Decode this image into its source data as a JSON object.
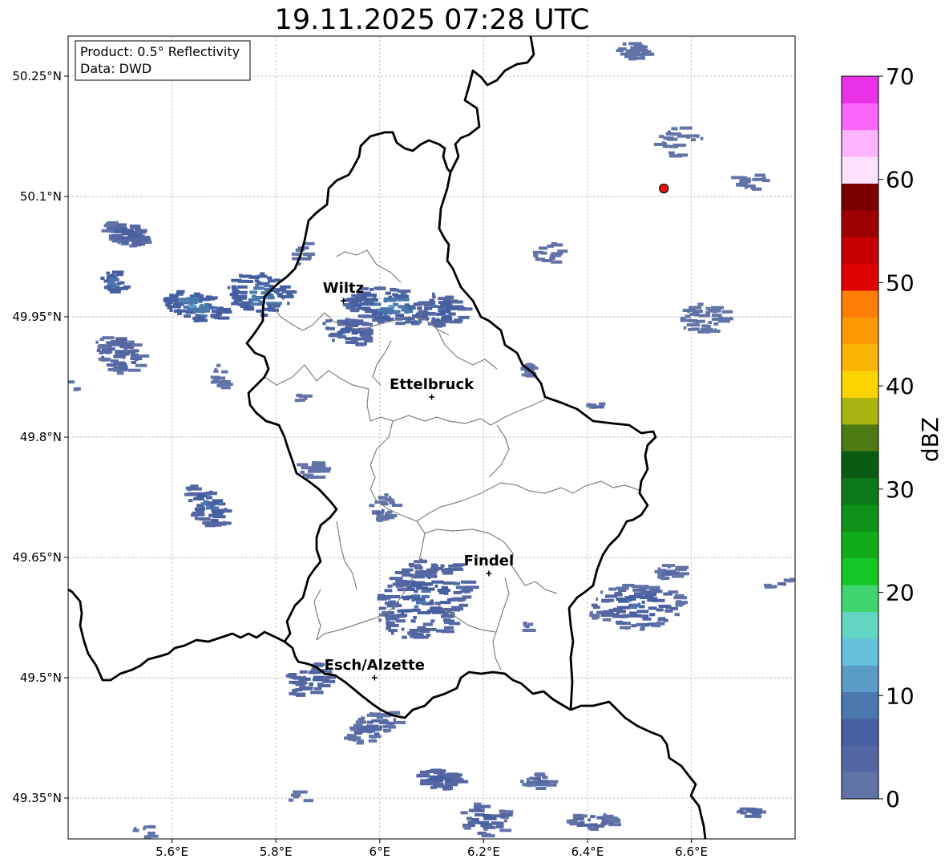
{
  "title": "19.11.2025 07:28 UTC",
  "info_box": {
    "product": "Product: 0.5° Reflectivity",
    "data": "Data: DWD"
  },
  "map": {
    "lon_range": [
      5.4,
      6.8
    ],
    "lat_range": [
      49.3,
      50.3
    ],
    "lon_ticks": [
      {
        "value": 5.6,
        "label": "5.6°E"
      },
      {
        "value": 5.8,
        "label": "5.8°E"
      },
      {
        "value": 6.0,
        "label": "6°E"
      },
      {
        "value": 6.2,
        "label": "6.2°E"
      },
      {
        "value": 6.4,
        "label": "6.4°E"
      },
      {
        "value": 6.6,
        "label": "6.6°E"
      }
    ],
    "lat_ticks": [
      {
        "value": 50.25,
        "label": "50.25°N"
      },
      {
        "value": 50.1,
        "label": "50.1°N"
      },
      {
        "value": 49.95,
        "label": "49.95°N"
      },
      {
        "value": 49.8,
        "label": "49.8°N"
      },
      {
        "value": 49.65,
        "label": "49.65°N"
      },
      {
        "value": 49.5,
        "label": "49.5°N"
      },
      {
        "value": 49.35,
        "label": "49.35°N"
      }
    ],
    "cities": [
      {
        "name": "Wiltz",
        "lon": 5.93,
        "lat": 49.97
      },
      {
        "name": "Ettelbruck",
        "lon": 6.1,
        "lat": 49.85
      },
      {
        "name": "Findel",
        "lon": 6.21,
        "lat": 49.63
      },
      {
        "name": "Esch/Alzette",
        "lon": 5.99,
        "lat": 49.5
      }
    ],
    "radar_site": {
      "lon": 6.547,
      "lat": 50.11,
      "color": "#ee1111"
    },
    "grid": true
  },
  "colorbar": {
    "label": "dBZ",
    "min": 0,
    "max": 70,
    "step": 5,
    "tick_values": [
      0,
      10,
      20,
      30,
      40,
      50,
      60,
      70
    ],
    "colors": [
      "#6273a8",
      "#5467a3",
      "#465fa1",
      "#4a77ad",
      "#5a9cc6",
      "#67c1dc",
      "#63d6c3",
      "#3fd46d",
      "#14c725",
      "#12ac1a",
      "#10911a",
      "#0d7818",
      "#0a5c12",
      "#4d7a13",
      "#abb411",
      "#fcd401",
      "#fbb304",
      "#fc9904",
      "#fd7d06",
      "#e00101",
      "#c60000",
      "#9c0000",
      "#780000",
      "#ffe1ff",
      "#ffb4ff",
      "#fd66fa",
      "#e932e7"
    ]
  }
}
